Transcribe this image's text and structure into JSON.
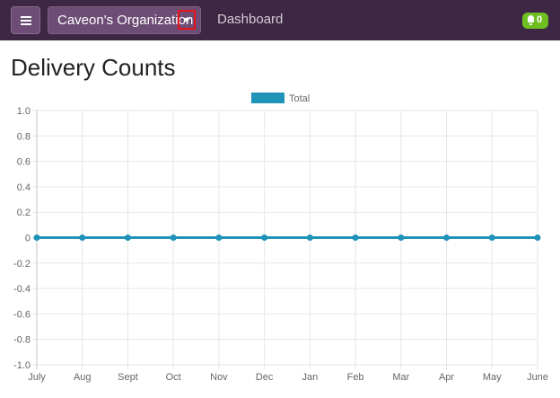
{
  "navbar": {
    "menu_icon": "hamburger-menu-icon",
    "organization": "Caveon's Organization",
    "caret_icon": "caret-down-icon",
    "dashboard_link": "Dashboard",
    "notification_icon": "bell-icon",
    "notification_count": "0"
  },
  "page": {
    "title": "Delivery Counts"
  },
  "colors": {
    "navbar": "#3e2744",
    "button": "#6d4d75",
    "series": "#1f93b8",
    "badge": "#6fbf21",
    "highlight": "#e8141c"
  },
  "chart_data": {
    "type": "line",
    "categories": [
      "July",
      "Aug",
      "Sept",
      "Oct",
      "Nov",
      "Dec",
      "Jan",
      "Feb",
      "Mar",
      "Apr",
      "May",
      "June"
    ],
    "series": [
      {
        "name": "Total",
        "values": [
          0,
          0,
          0,
          0,
          0,
          0,
          0,
          0,
          0,
          0,
          0,
          0
        ]
      }
    ],
    "ylim": [
      -1.0,
      1.0
    ],
    "yticks": [
      "1.0",
      "0.8",
      "0.6",
      "0.4",
      "0.2",
      "0",
      "-0.2",
      "-0.4",
      "-0.6",
      "-0.8",
      "-1.0"
    ],
    "grid": true,
    "legend": "top"
  }
}
